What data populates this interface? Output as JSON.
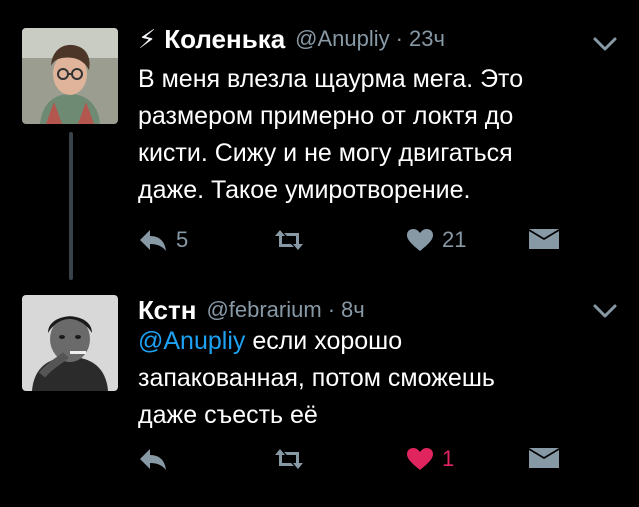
{
  "tweets": [
    {
      "display_name": "Коленька",
      "has_bolt": true,
      "handle": "@Anupliy",
      "separator": "·",
      "time": "23ч",
      "text": "В меня влезла щаурма мега. Это\nразмером примерно от локтя до\nкисти. Сижу и не могу двигаться\nдаже. Такое умиротворение.",
      "reply_count": "5",
      "retweet_count": "",
      "like_count": "21",
      "liked": false
    },
    {
      "display_name": "Кстн",
      "has_bolt": false,
      "handle": "@febrarium",
      "separator": "·",
      "time": "8ч",
      "mention": "@Anupliy",
      "text": " если хорошо\nзапакованная, потом сможешь\nдаже съесть её",
      "reply_count": "",
      "retweet_count": "",
      "like_count": "1",
      "liked": true
    }
  ],
  "colors": {
    "background": "#000000",
    "text": "#ffffff",
    "secondary": "#8899a6",
    "mention": "#1da1f2",
    "like_active": "#e0245e",
    "thread_line": "#39414a"
  },
  "icons": {
    "bolt": "lightning-bolt-icon",
    "chevron": "chevron-down-icon",
    "reply": "reply-icon",
    "retweet": "retweet-icon",
    "like": "heart-icon",
    "dm": "direct-message-icon"
  }
}
